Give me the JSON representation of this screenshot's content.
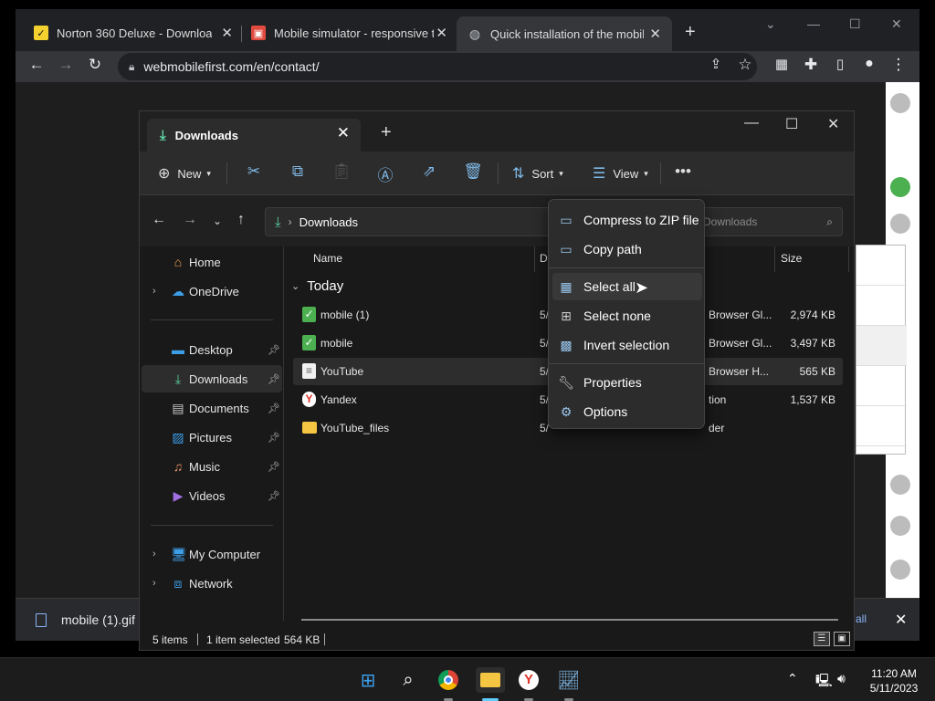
{
  "browser": {
    "tabs": [
      {
        "title": "Norton 360 Deluxe - Download",
        "icon": "norton-icon"
      },
      {
        "title": "Mobile simulator - responsive te",
        "icon": "mobile-simulator-icon"
      },
      {
        "title": "Quick installation of the mobile",
        "icon": "globe-icon"
      }
    ],
    "url": "webmobilefirst.com/en/contact/"
  },
  "download_bar": {
    "file": "mobile (1).gif",
    "show_all": "all"
  },
  "explorer": {
    "tab_title": "Downloads",
    "commands": {
      "new": "New",
      "sort": "Sort",
      "view": "View"
    },
    "address": {
      "location": "Downloads"
    },
    "search": {
      "placeholder": "Downloads"
    },
    "sidebar": {
      "home": "Home",
      "onedrive": "OneDrive",
      "desktop": "Desktop",
      "downloads": "Downloads",
      "documents": "Documents",
      "pictures": "Pictures",
      "music": "Music",
      "videos": "Videos",
      "my_computer": "My Computer",
      "network": "Network"
    },
    "columns": {
      "name": "Name",
      "date": "D",
      "size": "Size"
    },
    "group": "Today",
    "files": [
      {
        "name": "mobile (1)",
        "date": "5/",
        "type": "Browser Gl...",
        "size": "2,974 KB"
      },
      {
        "name": "mobile",
        "date": "5/",
        "type": "Browser Gl...",
        "size": "3,497 KB"
      },
      {
        "name": "YouTube",
        "date": "5/",
        "type": "Browser H...",
        "size": "565 KB"
      },
      {
        "name": "Yandex",
        "date": "5/",
        "type": "tion",
        "size": "1,537 KB"
      },
      {
        "name": "YouTube_files",
        "date": "5/",
        "type": "der",
        "size": ""
      }
    ],
    "status": {
      "items": "5 items",
      "selected": "1 item selected",
      "size": "564 KB"
    }
  },
  "context_menu": {
    "compress": "Compress to ZIP file",
    "copy_path": "Copy path",
    "select_all": "Select all",
    "select_none": "Select none",
    "invert": "Invert selection",
    "properties": "Properties",
    "options": "Options"
  },
  "taskbar": {
    "time": "11:20 AM",
    "date": "5/11/2023"
  },
  "colors": {
    "accent_green": "#5fd4a3",
    "icon_blue": "#7fb8e6",
    "folder_yellow": "#f4c542"
  }
}
